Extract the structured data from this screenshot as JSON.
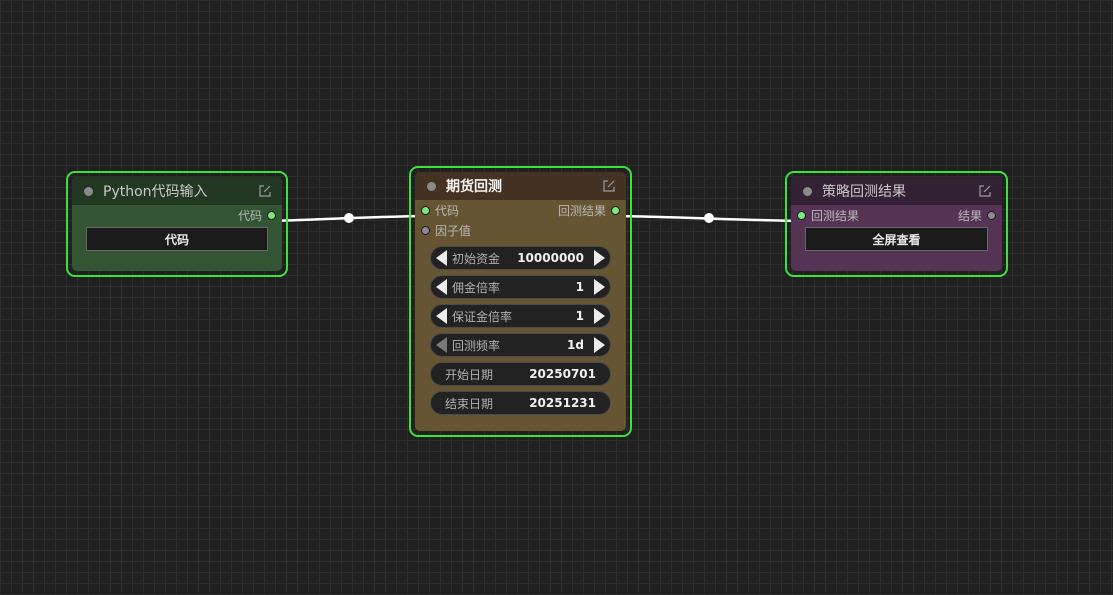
{
  "nodes": {
    "python_input": {
      "title": "Python代码输入",
      "output_label": "代码",
      "button_label": "代码"
    },
    "futures_backtest": {
      "title": "期货回测",
      "inputs": [
        "代码",
        "因子值"
      ],
      "output_label": "回测结果",
      "widgets": [
        {
          "label": "初始资金",
          "value": "10000000"
        },
        {
          "label": "佣金倍率",
          "value": "1"
        },
        {
          "label": "保证金倍率",
          "value": "1"
        },
        {
          "label": "回测频率",
          "value": "1d"
        },
        {
          "label": "开始日期",
          "value": "20250701"
        },
        {
          "label": "结束日期",
          "value": "20251231"
        }
      ]
    },
    "strategy_result": {
      "title": "策略回测结果",
      "input_label": "回测结果",
      "output_label": "结果",
      "button_label": "全屏查看"
    }
  },
  "colors": {
    "selected_border": "#3ee03e",
    "link": "#ffffff",
    "python_node_body": "#335533",
    "futures_node_body": "#665533",
    "result_node_body": "#553355"
  }
}
